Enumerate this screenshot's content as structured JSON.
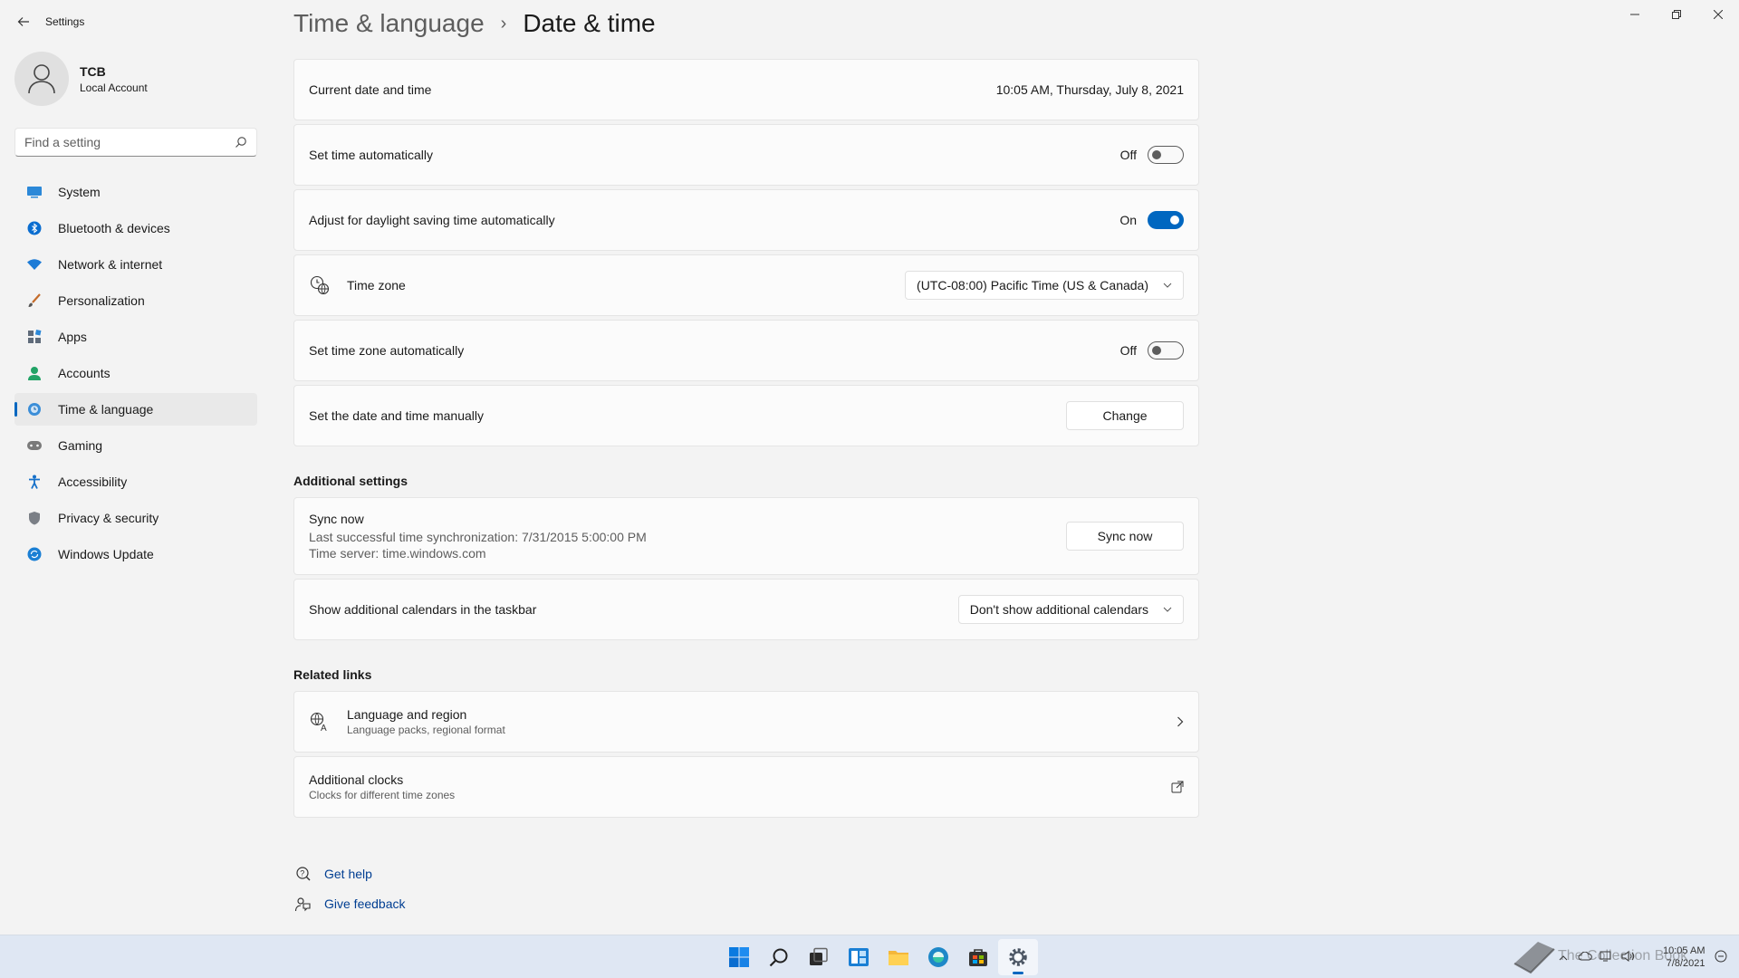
{
  "app": {
    "title": "Settings"
  },
  "profile": {
    "name": "TCB",
    "account_type": "Local Account"
  },
  "search": {
    "placeholder": "Find a setting"
  },
  "sidebar": {
    "items": [
      {
        "label": "System",
        "icon": "system-icon"
      },
      {
        "label": "Bluetooth & devices",
        "icon": "bluetooth-icon"
      },
      {
        "label": "Network & internet",
        "icon": "wifi-icon"
      },
      {
        "label": "Personalization",
        "icon": "brush-icon"
      },
      {
        "label": "Apps",
        "icon": "apps-icon"
      },
      {
        "label": "Accounts",
        "icon": "person-icon"
      },
      {
        "label": "Time & language",
        "icon": "globe-clock-icon",
        "active": true
      },
      {
        "label": "Gaming",
        "icon": "gamepad-icon"
      },
      {
        "label": "Accessibility",
        "icon": "accessibility-icon"
      },
      {
        "label": "Privacy & security",
        "icon": "shield-icon"
      },
      {
        "label": "Windows Update",
        "icon": "update-icon"
      }
    ]
  },
  "breadcrumb": {
    "parent": "Time & language",
    "separator": "›",
    "current": "Date & time"
  },
  "settings": {
    "current_date": {
      "label": "Current date and time",
      "value": "10:05 AM, Thursday, July 8, 2021"
    },
    "set_time_auto": {
      "label": "Set time automatically",
      "state": "Off",
      "on": false
    },
    "daylight": {
      "label": "Adjust for daylight saving time automatically",
      "state": "On",
      "on": true
    },
    "time_zone": {
      "label": "Time zone",
      "value": "(UTC-08:00) Pacific Time (US & Canada)"
    },
    "tz_auto": {
      "label": "Set time zone automatically",
      "state": "Off",
      "on": false
    },
    "manual": {
      "label": "Set the date and time manually",
      "button": "Change"
    }
  },
  "additional": {
    "title": "Additional settings",
    "sync": {
      "title": "Sync now",
      "last_sync": "Last successful time synchronization: 7/31/2015 5:00:00 PM",
      "server": "Time server: time.windows.com",
      "button": "Sync now"
    },
    "calendars": {
      "label": "Show additional calendars in the taskbar",
      "value": "Don't show additional calendars"
    }
  },
  "related": {
    "title": "Related links",
    "language": {
      "title": "Language and region",
      "subtitle": "Language packs, regional format"
    },
    "clocks": {
      "title": "Additional clocks",
      "subtitle": "Clocks for different time zones"
    }
  },
  "help": {
    "get_help": "Get help",
    "feedback": "Give feedback"
  },
  "taskbar": {
    "clock_time": "10:05 AM",
    "clock_date": "7/8/2021",
    "accent": "#0067c0"
  },
  "watermark": "The Collection Book"
}
